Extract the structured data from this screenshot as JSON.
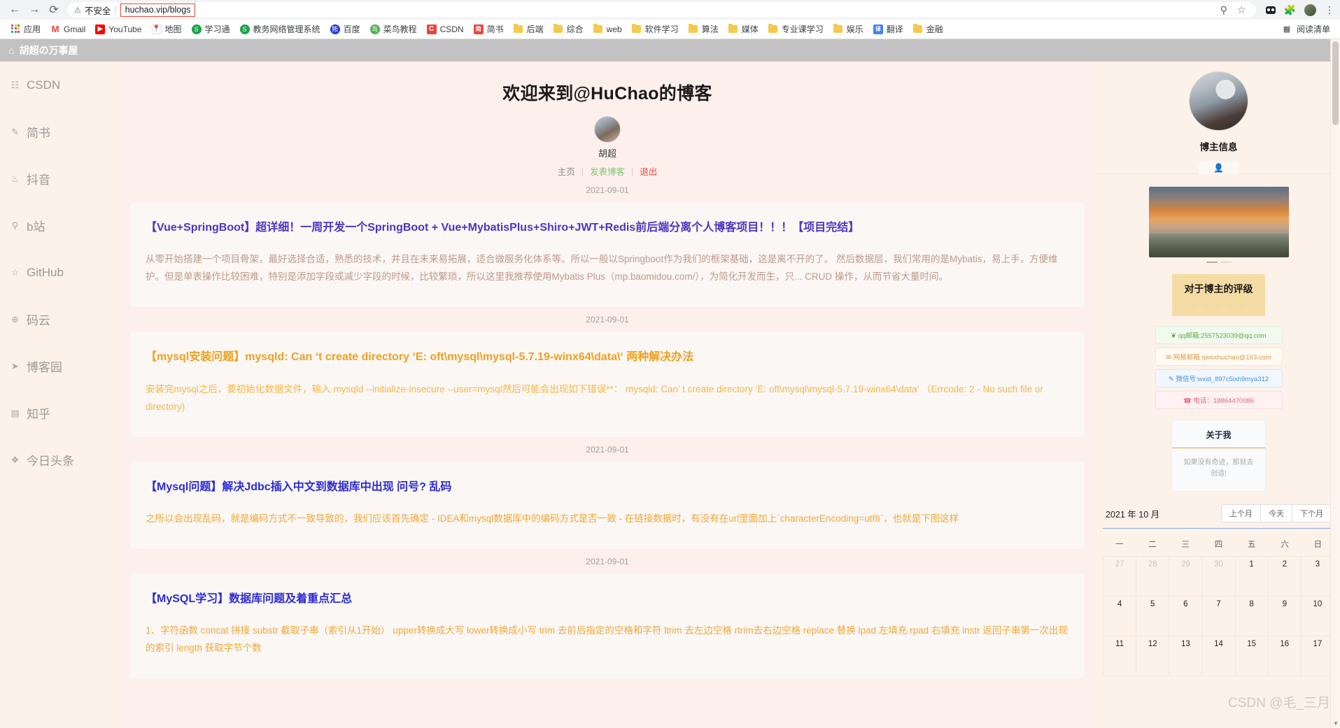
{
  "browser": {
    "back_icon": "back-arrow-icon",
    "forward_icon": "forward-arrow-icon",
    "reload_icon": "reload-icon",
    "insecure_label": "不安全",
    "url": "huchao.vip/blogs",
    "search_icon": "search-icon",
    "bookmark_star_icon": "star-icon",
    "extension_icon": "puzzle-icon",
    "profile_icon": "profile-avatar-icon",
    "menu_icon": "three-dot-menu-icon",
    "reading_list": "阅读清单"
  },
  "bookmarks": [
    {
      "label": "应用",
      "icon": "apps-grid-icon",
      "color": "#4285f4"
    },
    {
      "label": "Gmail",
      "icon": "gmail-icon",
      "color": "#ea4335"
    },
    {
      "label": "YouTube",
      "icon": "youtube-icon",
      "color": "#ff0000"
    },
    {
      "label": "地图",
      "icon": "maps-icon",
      "color": "#34a853"
    },
    {
      "label": "学习通",
      "icon": "globe-icon",
      "color": "#1aa34a"
    },
    {
      "label": "教务网络管理系统",
      "icon": "globe-icon",
      "color": "#1aa34a"
    },
    {
      "label": "百度",
      "icon": "baidu-icon",
      "color": "#2932e1"
    },
    {
      "label": "菜鸟教程",
      "icon": "runoob-icon",
      "color": "#4caf50"
    },
    {
      "label": "CSDN",
      "icon": "csdn-icon",
      "color": "#e8453c"
    },
    {
      "label": "简书",
      "icon": "jianshu-icon",
      "color": "#e8453c"
    },
    {
      "label": "后端",
      "icon": "folder-icon",
      "color": "#f5c94c"
    },
    {
      "label": "综合",
      "icon": "folder-icon",
      "color": "#f5c94c"
    },
    {
      "label": "web",
      "icon": "folder-icon",
      "color": "#f5c94c"
    },
    {
      "label": "软件学习",
      "icon": "folder-icon",
      "color": "#f5c94c"
    },
    {
      "label": "算法",
      "icon": "folder-icon",
      "color": "#f5c94c"
    },
    {
      "label": "媒体",
      "icon": "folder-icon",
      "color": "#f5c94c"
    },
    {
      "label": "专业课学习",
      "icon": "folder-icon",
      "color": "#f5c94c"
    },
    {
      "label": "娱乐",
      "icon": "folder-icon",
      "color": "#f5c94c"
    },
    {
      "label": "翻译",
      "icon": "translate-icon",
      "color": "#4285f4"
    },
    {
      "label": "金融",
      "icon": "folder-icon",
      "color": "#f5c94c"
    }
  ],
  "sidebar": {
    "brand": "胡超の万事屋",
    "brand_icon": "home-icon",
    "items": [
      {
        "label": "CSDN",
        "icon": "csdn-nav-icon"
      },
      {
        "label": "简书",
        "icon": "pencil-icon"
      },
      {
        "label": "抖音",
        "icon": "music-note-icon"
      },
      {
        "label": "b站",
        "icon": "bilibili-icon"
      },
      {
        "label": "GitHub",
        "icon": "star-outline-icon"
      },
      {
        "label": "码云",
        "icon": "grid-icon"
      },
      {
        "label": "博客园",
        "icon": "paper-plane-icon"
      },
      {
        "label": "知乎",
        "icon": "comment-icon"
      },
      {
        "label": "今日头条",
        "icon": "compass-icon"
      }
    ]
  },
  "main": {
    "welcome_title": "欢迎来到@HuChao的博客",
    "profile_name": "胡超",
    "nav": {
      "home": "主页",
      "post": "发表博客",
      "logout": "退出",
      "separator": "|"
    },
    "posts": [
      {
        "date": "2021-09-01",
        "title": "【Vue+SpringBoot】超详细！一周开发一个SpringBoot + Vue+MybatisPlus+Shiro+JWT+Redis前后端分离个人博客项目！！！【项目完结】",
        "title_color": "purple",
        "body": "从零开始搭建一个项目骨架，最好选择合适，熟悉的技术，并且在未来易拓展，适合微服务化体系等。所以一般以Springboot作为我们的框架基础，这是离不开的了。 然后数据层，我们常用的是Mybatis，易上手，方便维护。但是单表操作比较困难，特别是添加字段或减少字段的时候，比较繁琐，所以这里我推荐使用Mybatis Plus（mp.baomidou.com/），为简化开发而生，只... CRUD 操作，从而节省大量时间。",
        "body_color": "pink"
      },
      {
        "date": "2021-09-01",
        "title": "【mysql安装问题】mysqld: Can ‘t create directory ‘E: oft\\mysql\\mysql-5.7.19-winx64\\data\\‘ 两种解决办法",
        "title_color": "orange",
        "body": "安装完mysql之后，要初始化数据文件，输入 mysqld --initialize-insecure --user=mysql然后可能会出现如下错误**： mysqld: Can’ t create directory ‘E: oft\\mysql\\mysql-5.7.19-winx64\\data’ （Errcode: 2 - No such file or directory)",
        "body_color": "amber"
      },
      {
        "date": "2021-09-01",
        "title": "【Mysql问题】解决Jdbc插入中文到数据库中出现 问号? 乱码",
        "title_color": "blue",
        "body": "之所以会出现乱码，就是编码方式不一致导致的，我们应该首先确定 - IDEA和mysql数据库中的编码方式是否一致 - 在链接数据时，有没有在url里面加上`characterEncoding=utf8`，也就是下图这样",
        "body_color": "gold"
      },
      {
        "date": "2021-09-01",
        "title": "【MySQL学习】数据库问题及着重点汇总",
        "title_color": "blue",
        "body": "1、字符函数 concat 拼接 substr 截取子串（索引从1开始） upper转换成大写 lower转换成小写 trim 去前后指定的空格和字符 ltrim 去左边空格 rtrim去右边空格 replace 替换 lpad 左填充 rpad 右填充 instr 返回子串第一次出现的索引 length 获取字节个数",
        "body_color": "gold"
      }
    ]
  },
  "right_rail": {
    "title": "博主信息",
    "tab_icon": "person-icon",
    "rating": {
      "title": "对于博主的评级",
      "stars": "☆ ☆ ☆ ☆ ☆"
    },
    "contacts": [
      {
        "icon": "qq-penguin-icon",
        "text": "qq邮箱:2557523039@qq.com",
        "style": "c-qq"
      },
      {
        "icon": "mail-icon",
        "text": "网易邮箱 qwoxhuchao@163.com",
        "style": "c-163"
      },
      {
        "icon": "wechat-icon",
        "text": "微信号:wxid_897c5ixh9mya312",
        "style": "c-wx"
      },
      {
        "icon": "phone-icon",
        "text": "电话：18864470086",
        "style": "c-tel"
      }
    ],
    "about": {
      "title": "关于我",
      "text": "如果没有奇迹，那就去创造!"
    },
    "calendar": {
      "month_label": "2021 年 10 月",
      "prev_label": "上个月",
      "today_label": "今天",
      "next_label": "下个月",
      "weekdays": [
        "一",
        "二",
        "三",
        "四",
        "五",
        "六",
        "日"
      ],
      "weeks": [
        [
          {
            "d": "27",
            "muted": true
          },
          {
            "d": "28",
            "muted": true
          },
          {
            "d": "29",
            "muted": true
          },
          {
            "d": "30",
            "muted": true
          },
          {
            "d": "1"
          },
          {
            "d": "2"
          },
          {
            "d": "3"
          }
        ],
        [
          {
            "d": "4"
          },
          {
            "d": "5"
          },
          {
            "d": "6"
          },
          {
            "d": "7"
          },
          {
            "d": "8"
          },
          {
            "d": "9"
          },
          {
            "d": "10"
          }
        ],
        [
          {
            "d": "11"
          },
          {
            "d": "12"
          },
          {
            "d": "13"
          },
          {
            "d": "14"
          },
          {
            "d": "15"
          },
          {
            "d": "16"
          },
          {
            "d": "17"
          }
        ]
      ]
    },
    "watermark": "CSDN @毛_三月"
  }
}
